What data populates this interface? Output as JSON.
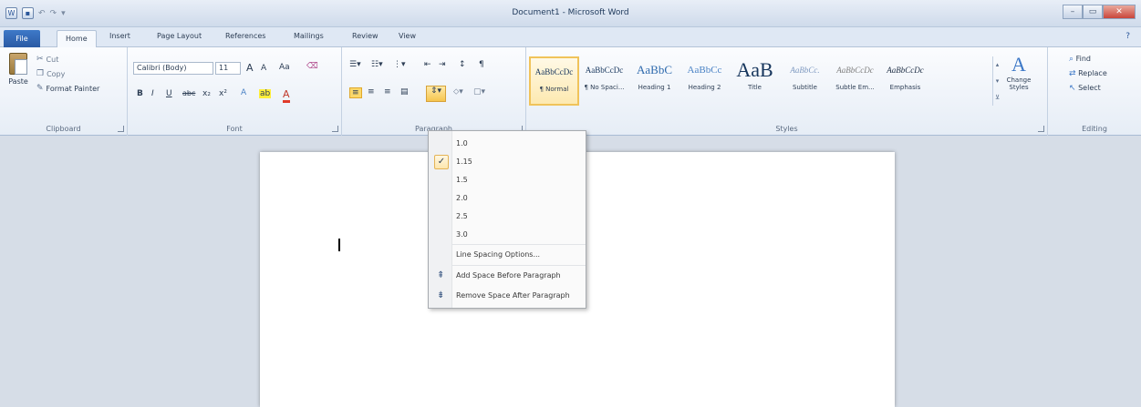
{
  "window": {
    "title": "Document1 - Microsoft Word",
    "controls": [
      "–",
      "▭",
      "✕"
    ]
  },
  "qat": {
    "icons": [
      "word-app-icon",
      "save-icon",
      "undo-icon",
      "redo-icon"
    ]
  },
  "tabs": {
    "file": "File",
    "items": [
      "Home",
      "Insert",
      "Page Layout",
      "References",
      "Mailings",
      "Review",
      "View"
    ],
    "active": "Home"
  },
  "ribbon": {
    "clipboard": {
      "label": "Clipboard",
      "paste": "Paste",
      "cut": "Cut",
      "copy": "Copy",
      "format_painter": "Format Painter"
    },
    "font": {
      "label": "Font",
      "font_name": "Calibri (Body)",
      "font_size": "11",
      "grow": "A",
      "shrink": "A",
      "change_case": "Aa",
      "clear": "",
      "bold": "B",
      "italic": "I",
      "underline": "U",
      "strike": "abc",
      "subscript": "x₂",
      "superscript": "x²",
      "text_effects": "A",
      "highlight": "ab",
      "font_color": "A"
    },
    "paragraph": {
      "label": "Paragraph"
    },
    "styles": {
      "label": "Styles",
      "items": [
        {
          "sample": "AaBbCcDc",
          "name": "¶ Normal",
          "selected": true,
          "variant": ""
        },
        {
          "sample": "AaBbCcDc",
          "name": "¶ No Spaci...",
          "selected": false,
          "variant": ""
        },
        {
          "sample": "AaBbC",
          "name": "Heading 1",
          "selected": false,
          "variant": "h1"
        },
        {
          "sample": "AaBbCc",
          "name": "Heading 2",
          "selected": false,
          "variant": "h2"
        },
        {
          "sample": "AaB",
          "name": "Title",
          "selected": false,
          "variant": "title"
        },
        {
          "sample": "AaBbCc.",
          "name": "Subtitle",
          "selected": false,
          "variant": "sub"
        },
        {
          "sample": "AaBbCcDc",
          "name": "Subtle Em...",
          "selected": false,
          "variant": "se"
        },
        {
          "sample": "AaBbCcDc",
          "name": "Emphasis",
          "selected": false,
          "variant": "em"
        }
      ],
      "change_styles": "Change Styles"
    },
    "editing": {
      "label": "Editing",
      "find": "Find",
      "replace": "Replace",
      "select": "Select"
    }
  },
  "line_spacing_menu": {
    "options": [
      "1.0",
      "1.15",
      "1.5",
      "2.0",
      "2.5",
      "3.0"
    ],
    "checked": "1.15",
    "line_spacing_options": "Line Spacing Options...",
    "add_space_before": "Add Space Before Paragraph",
    "remove_space_after": "Remove Space After Paragraph"
  }
}
